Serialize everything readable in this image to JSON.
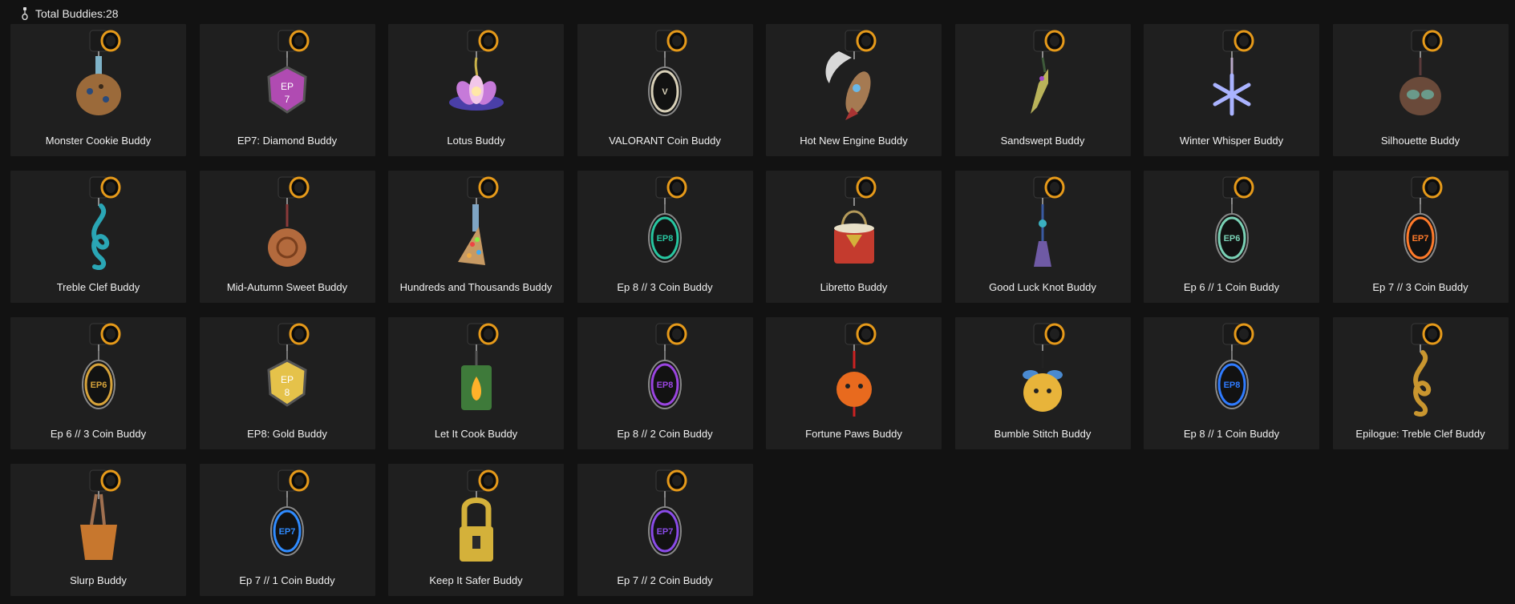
{
  "header": {
    "icon": "buddy-keychain-icon",
    "title": "Total Buddies:28"
  },
  "buddies": [
    {
      "name": "Monster Cookie Buddy",
      "charm": "cookie",
      "color": "#9b6a3a"
    },
    {
      "name": "EP7: Diamond Buddy",
      "charm": "badge",
      "color": "#b04bb2",
      "text": "EP\n7"
    },
    {
      "name": "Lotus Buddy",
      "charm": "lotus",
      "color": "#c67ad9"
    },
    {
      "name": "VALORANT Coin Buddy",
      "charm": "coin",
      "color": "#d8d0b8",
      "text": "V"
    },
    {
      "name": "Hot New Engine Buddy",
      "charm": "rocket",
      "color": "#a57a52"
    },
    {
      "name": "Sandswept Buddy",
      "charm": "dagger",
      "color": "#b9b35a"
    },
    {
      "name": "Winter Whisper Buddy",
      "charm": "snowflake",
      "color": "#aab3ff"
    },
    {
      "name": "Silhouette Buddy",
      "charm": "mask",
      "color": "#6a4a3a"
    },
    {
      "name": "Treble Clef Buddy",
      "charm": "clef",
      "color": "#2aa6b5"
    },
    {
      "name": "Mid-Autumn Sweet Buddy",
      "charm": "mooncake",
      "color": "#b36a3d"
    },
    {
      "name": "Hundreds and Thousands Buddy",
      "charm": "slice",
      "color": "#c79a63"
    },
    {
      "name": "Ep 8 // 3 Coin Buddy",
      "charm": "coin",
      "color": "#27c6a0",
      "text": "EP8"
    },
    {
      "name": "Libretto Buddy",
      "charm": "drum",
      "color": "#c43b2e"
    },
    {
      "name": "Good Luck Knot Buddy",
      "charm": "tassel",
      "color": "#6f5aa5"
    },
    {
      "name": "Ep 6 // 1 Coin Buddy",
      "charm": "coin",
      "color": "#7ad1b5",
      "text": "EP6"
    },
    {
      "name": "Ep 7 // 3 Coin Buddy",
      "charm": "coin",
      "color": "#ff7a2a",
      "text": "EP7"
    },
    {
      "name": "Ep 6 // 3 Coin Buddy",
      "charm": "coin",
      "color": "#d7a33a",
      "text": "EP6"
    },
    {
      "name": "EP8: Gold Buddy",
      "charm": "badge",
      "color": "#e5c24a",
      "text": "EP\n8"
    },
    {
      "name": "Let It Cook Buddy",
      "charm": "lantern",
      "color": "#3e7a3a"
    },
    {
      "name": "Ep 8 // 2 Coin Buddy",
      "charm": "coin",
      "color": "#9a45e0",
      "text": "EP8"
    },
    {
      "name": "Fortune Paws Buddy",
      "charm": "tiger",
      "color": "#e86a1e"
    },
    {
      "name": "Bumble Stitch Buddy",
      "charm": "bee",
      "color": "#e8b43a"
    },
    {
      "name": "Ep 8 // 1 Coin Buddy",
      "charm": "coin",
      "color": "#2f7bff",
      "text": "EP8"
    },
    {
      "name": "Epilogue: Treble Clef Buddy",
      "charm": "clef",
      "color": "#c9962f"
    },
    {
      "name": "Slurp Buddy",
      "charm": "cup",
      "color": "#c7772e"
    },
    {
      "name": "Ep 7 // 1 Coin Buddy",
      "charm": "coin",
      "color": "#2f8bff",
      "text": "EP7"
    },
    {
      "name": "Keep It Safer Buddy",
      "charm": "lock",
      "color": "#d4b13a"
    },
    {
      "name": "Ep 7 // 2 Coin Buddy",
      "charm": "coin",
      "color": "#8a4be8",
      "text": "EP7"
    }
  ]
}
